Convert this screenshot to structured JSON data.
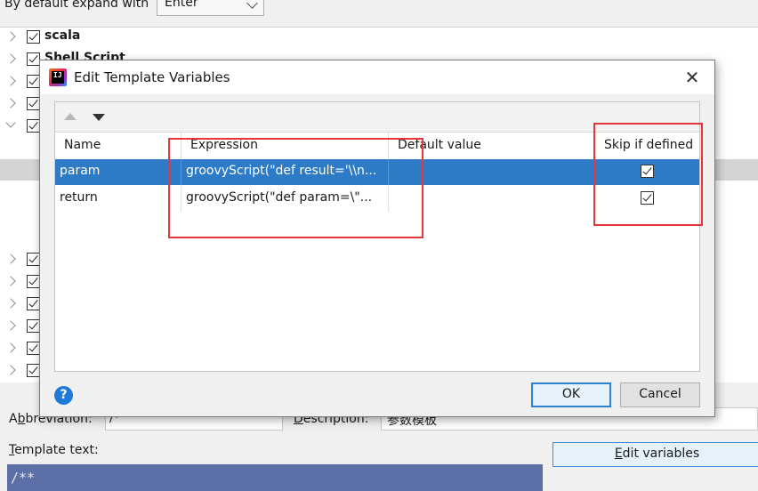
{
  "background": {
    "expand_label": "By default expand with",
    "expand_value": "Enter",
    "tree_items": [
      {
        "label": "scala",
        "expanded": false
      },
      {
        "label": "Shell Script",
        "expanded": false
      },
      {
        "label": "",
        "expanded": false
      },
      {
        "label": "",
        "expanded": false
      },
      {
        "label": "",
        "expanded": true
      },
      {
        "label": "",
        "expanded": false
      },
      {
        "label": "",
        "expanded": false
      },
      {
        "label": "",
        "expanded": false
      },
      {
        "label": "",
        "expanded": false
      },
      {
        "label": "",
        "expanded": false
      },
      {
        "label": "",
        "expanded": false
      }
    ],
    "abbreviation_label": "Abbreviation:",
    "abbreviation_mnemonic": "b",
    "abbreviation_value": "/*",
    "description_label": "Description:",
    "description_mnemonic": "D",
    "description_value": "参数模板",
    "template_text_label": "Template text:",
    "template_text_mnemonic": "T",
    "template_text_value": "/**",
    "edit_variables_label": "Edit variables",
    "edit_variables_mnemonic": "E"
  },
  "dialog": {
    "title": "Edit Template Variables",
    "close_glyph": "✕",
    "columns": [
      "Name",
      "Expression",
      "Default value",
      "Skip if defined"
    ],
    "rows": [
      {
        "name": "param",
        "expression": "groovyScript(\"def result='\\\\n...",
        "default_value": "",
        "skip_if_defined": true,
        "selected": true
      },
      {
        "name": "return",
        "expression": "groovyScript(\"def param=\\\"...",
        "default_value": "",
        "skip_if_defined": true,
        "selected": false
      }
    ],
    "help_glyph": "?",
    "ok_label": "OK",
    "cancel_label": "Cancel",
    "accent_color": "#2d7ac6",
    "annotation_color": "#e8343c"
  }
}
